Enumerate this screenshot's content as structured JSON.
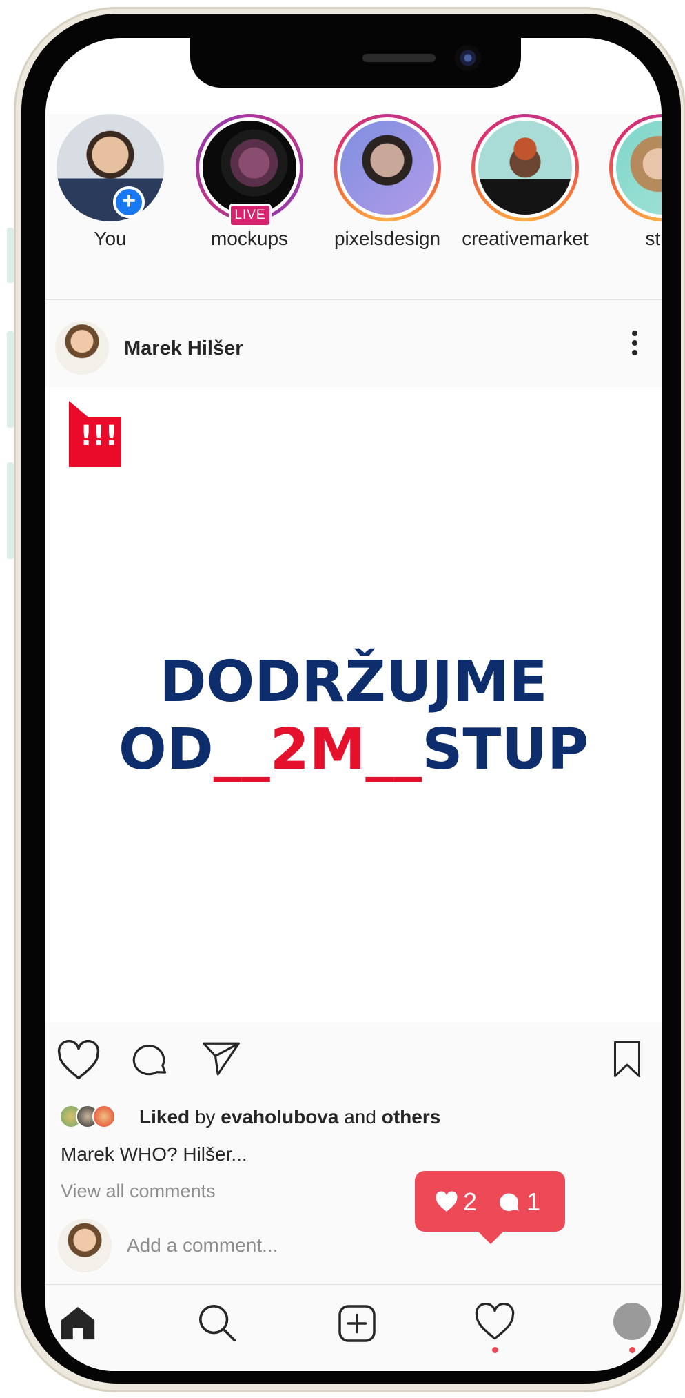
{
  "stories": [
    {
      "label": "You",
      "ring": "none",
      "badge": "add"
    },
    {
      "label": "mockups",
      "ring": "live",
      "badge": "live",
      "badge_text": "LIVE"
    },
    {
      "label": "pixelsdesign",
      "ring": "pink"
    },
    {
      "label": "creativemarket",
      "ring": "pink"
    },
    {
      "label": "stuc",
      "ring": "pink"
    }
  ],
  "post": {
    "author": "Marek Hilšer",
    "flag_text": "!!!",
    "slogan_line1": "DODRŽUJME",
    "slogan_line2_a": "OD",
    "slogan_line2_red": "__2M__",
    "slogan_line2_b": "STUP",
    "likes": {
      "liked": "Liked",
      "by": "by",
      "user": "evaholubova",
      "and": "and",
      "others": "others"
    },
    "caption": "Marek WHO? Hilšer...",
    "view_comments": "View all comments",
    "comment_placeholder": "Add a comment..."
  },
  "notification": {
    "likes": "2",
    "comments": "1"
  },
  "colors": {
    "accent_red": "#ed4956",
    "slogan_blue": "#0d2d6c",
    "slogan_red": "#e5112c",
    "add_blue": "#1877f2"
  },
  "icons": [
    "add-icon",
    "heart-icon",
    "comment-icon",
    "send-icon",
    "bookmark-icon",
    "more-icon",
    "home-icon",
    "search-icon",
    "new-post-icon",
    "profile-icon"
  ]
}
